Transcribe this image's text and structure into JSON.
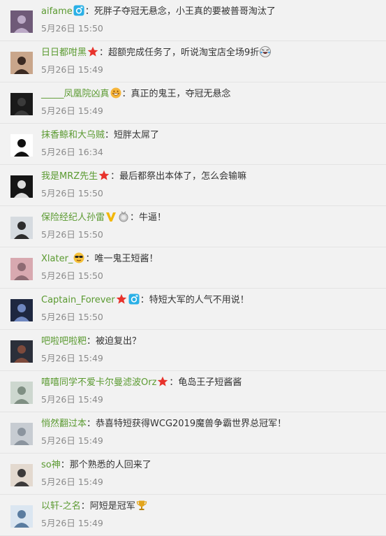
{
  "comments": [
    {
      "name": "aifame",
      "text": "死胖子夺冠无悬念，小王真的要被普哥淘汰了",
      "time": "5月26日 15:50",
      "badges": [
        "camera-icon"
      ],
      "avatar": {
        "bg": "#6f5a78",
        "fg": "#bcaac7"
      }
    },
    {
      "name": "日日都咁黑",
      "text": "超额完成任务了，听说淘宝店全场9折",
      "time": "5月26日 15:49",
      "badges": [
        "star-icon"
      ],
      "trailing": [
        "laugh-cry-emoji-icon"
      ],
      "avatar": {
        "bg": "#c9a68b",
        "fg": "#3b2a22"
      }
    },
    {
      "name": "_____凤凰院凶真",
      "text": "真正的鬼王，夺冠无悬念",
      "time": "5月26日 15:49",
      "badges": [
        "grin-emoji-icon"
      ],
      "avatar": {
        "bg": "#1a1a1a",
        "fg": "#3a3a3a"
      }
    },
    {
      "name": "抹香鲸和大乌贼",
      "text": "短胖太屌了",
      "time": "5月26日 16:34",
      "badges": [],
      "avatar": {
        "bg": "#ffffff",
        "fg": "#111111"
      }
    },
    {
      "name": "我是MRZ先生",
      "text": "最后都祭出本体了，怎么会输嘛",
      "time": "5月26日 15:50",
      "badges": [
        "star-icon"
      ],
      "avatar": {
        "bg": "#151515",
        "fg": "#dddddd"
      }
    },
    {
      "name": "保险经纪人孙雷",
      "text": "牛逼！",
      "time": "5月26日 15:50",
      "badges": [
        "verified-v-icon",
        "medal-icon"
      ],
      "avatar": {
        "bg": "#d6dbe0",
        "fg": "#2d2d2d"
      }
    },
    {
      "name": "Xlater_",
      "text": "唯一鬼王短酱！",
      "time": "5月26日 15:50",
      "badges": [
        "sunglasses-emoji-icon"
      ],
      "avatar": {
        "bg": "#d8a9b0",
        "fg": "#8e6b73"
      }
    },
    {
      "name": "Captain_Forever",
      "text": "特短大军的人气不用说！",
      "time": "5月26日 15:50",
      "badges": [
        "star-icon",
        "camera-icon"
      ],
      "avatar": {
        "bg": "#1e2740",
        "fg": "#6f87c0"
      }
    },
    {
      "name": "吧啦吧啦粑",
      "text": "被迫复出？",
      "time": "5月26日 15:49",
      "badges": [],
      "avatar": {
        "bg": "#2b2f3a",
        "fg": "#7d4a3c"
      }
    },
    {
      "name": "嘻嘻同学不爱卡尔曼滤波Orz",
      "text": "龟岛王子短酱酱",
      "time": "5月26日 15:49",
      "badges": [
        "star-icon"
      ],
      "avatar": {
        "bg": "#cdd7cf",
        "fg": "#7f8f83"
      }
    },
    {
      "name": "悄然翻过本",
      "text": "恭喜特短获得WCG2019魔兽争霸世界总冠军！",
      "time": "5月26日 15:49",
      "badges": [],
      "avatar": {
        "bg": "#c7ccd2",
        "fg": "#8b949e"
      }
    },
    {
      "name": "so神",
      "text": "那个熟悉的人回来了",
      "time": "5月26日 15:49",
      "badges": [],
      "avatar": {
        "bg": "#e3d9cf",
        "fg": "#3c3a3a"
      }
    },
    {
      "name": "以轩-之名",
      "text": "阿短是冠军",
      "time": "5月26日 15:49",
      "badges": [],
      "trailing": [
        "trophy-icon"
      ],
      "avatar": {
        "bg": "#dbe6f1",
        "fg": "#5a7ca0"
      }
    }
  ],
  "colors": {
    "name": "#5b9a31",
    "text": "#333333",
    "time": "#8a8a8a",
    "background": "#f2f2f2",
    "divider": "#e3e3e3"
  }
}
